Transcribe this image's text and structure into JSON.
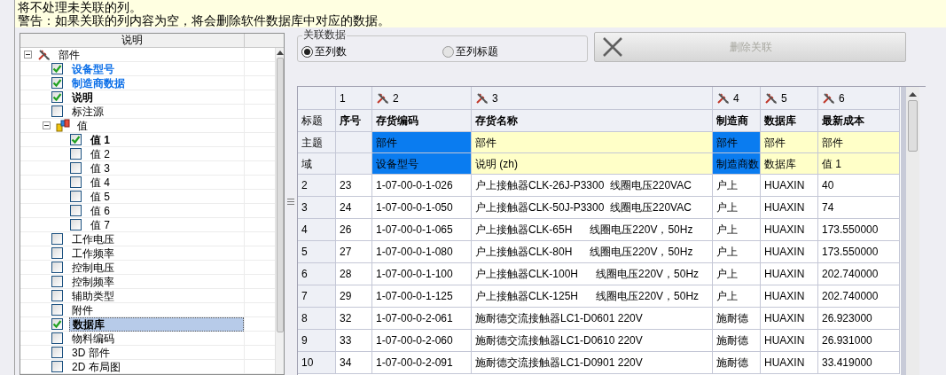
{
  "notice": {
    "lines": [
      "将不处理未关联的列。",
      "警告：如果关联的列内容为空，将会删除软件数据库中对应的数据。"
    ]
  },
  "tree": {
    "column_header": "说明",
    "items": [
      {
        "label": "部件",
        "kind": "component",
        "expanded": true,
        "children": [
          {
            "label": "设备型号",
            "kind": "field",
            "checked": true,
            "linked": true,
            "selected": false
          },
          {
            "label": "制造商数据",
            "kind": "field",
            "checked": true,
            "linked": true,
            "selected": false
          },
          {
            "label": "说明",
            "kind": "field",
            "checked": true,
            "linked": false,
            "selected": false
          },
          {
            "label": "标注源",
            "kind": "field",
            "checked": false,
            "linked": false,
            "selected": false
          },
          {
            "label": "值",
            "kind": "value-set",
            "expanded": true,
            "children": [
              {
                "label": "值 1",
                "kind": "field",
                "checked": true,
                "linked": false,
                "selected": false
              },
              {
                "label": "值 2",
                "kind": "field",
                "checked": false,
                "linked": false,
                "selected": false
              },
              {
                "label": "值 3",
                "kind": "field",
                "checked": false,
                "linked": false,
                "selected": false
              },
              {
                "label": "值 4",
                "kind": "field",
                "checked": false,
                "linked": false,
                "selected": false
              },
              {
                "label": "值 5",
                "kind": "field",
                "checked": false,
                "linked": false,
                "selected": false
              },
              {
                "label": "值 6",
                "kind": "field",
                "checked": false,
                "linked": false,
                "selected": false
              },
              {
                "label": "值 7",
                "kind": "field",
                "checked": false,
                "linked": false,
                "selected": false
              }
            ]
          },
          {
            "label": "工作电压",
            "kind": "field",
            "checked": false,
            "linked": false,
            "selected": false
          },
          {
            "label": "工作频率",
            "kind": "field",
            "checked": false,
            "linked": false,
            "selected": false
          },
          {
            "label": "控制电压",
            "kind": "field",
            "checked": false,
            "linked": false,
            "selected": false
          },
          {
            "label": "控制频率",
            "kind": "field",
            "checked": false,
            "linked": false,
            "selected": false
          },
          {
            "label": "辅助类型",
            "kind": "field",
            "checked": false,
            "linked": false,
            "selected": false
          },
          {
            "label": "附件",
            "kind": "field",
            "checked": false,
            "linked": false,
            "selected": false
          },
          {
            "label": "数据库",
            "kind": "field",
            "checked": true,
            "linked": false,
            "selected": true
          },
          {
            "label": "物料编码",
            "kind": "field",
            "checked": false,
            "linked": false,
            "selected": false
          },
          {
            "label": "3D 部件",
            "kind": "field",
            "checked": false,
            "linked": false,
            "selected": false
          },
          {
            "label": "2D 布局图",
            "kind": "field",
            "checked": false,
            "linked": false,
            "selected": false
          }
        ]
      }
    ]
  },
  "link_group": {
    "title": "关联数据",
    "options": [
      {
        "label": "至列数",
        "selected": true
      },
      {
        "label": "至列标题",
        "selected": false
      }
    ]
  },
  "delete_button": {
    "label": "删除关联",
    "disabled": true
  },
  "table": {
    "row_labels": [
      "标题",
      "主题",
      "域"
    ],
    "columns": [
      {
        "number": "1",
        "linked": false,
        "selected": false,
        "title": "序号"
      },
      {
        "number": "2",
        "linked": true,
        "selected": true,
        "title": "存货编码",
        "subject": "部件",
        "field": "设备型号"
      },
      {
        "number": "3",
        "linked": true,
        "selected": false,
        "title": "存货名称",
        "subject": "部件",
        "field": "说明 (zh)"
      },
      {
        "number": "4",
        "linked": true,
        "selected": true,
        "title": "制造商",
        "subject": "部件",
        "field": "制造商数"
      },
      {
        "number": "5",
        "linked": true,
        "selected": false,
        "title": "数据库",
        "subject": "部件",
        "field": "数据库"
      },
      {
        "number": "6",
        "linked": true,
        "selected": false,
        "title": "最新成本",
        "subject": "部件",
        "field": "值 1"
      }
    ],
    "rows": [
      {
        "row": "2",
        "cells": [
          "23",
          "1-07-00-0-1-026",
          "户上接触器CLK-26J-P3300  线圈电压220VAC",
          "户上",
          "HUAXIN",
          "40"
        ]
      },
      {
        "row": "3",
        "cells": [
          "24",
          "1-07-00-0-1-050",
          "户上接触器CLK-50J-P3300  线圈电压220VAC",
          "户上",
          "HUAXIN",
          "74"
        ]
      },
      {
        "row": "4",
        "cells": [
          "26",
          "1-07-00-0-1-065",
          "户上接触器CLK-65H      线圈电压220V，50Hz",
          "户上",
          "HUAXIN",
          "173.550000"
        ]
      },
      {
        "row": "5",
        "cells": [
          "27",
          "1-07-00-0-1-080",
          "户上接触器CLK-80H      线圈电压220V，50Hz",
          "户上",
          "HUAXIN",
          "173.550000"
        ]
      },
      {
        "row": "6",
        "cells": [
          "28",
          "1-07-00-0-1-100",
          "户上接触器CLK-100H      线圈电压220V，50Hz",
          "户上",
          "HUAXIN",
          "202.740000"
        ]
      },
      {
        "row": "7",
        "cells": [
          "29",
          "1-07-00-0-1-125",
          "户上接触器CLK-125H      线圈电压220V，50Hz",
          "户上",
          "HUAXIN",
          "202.740000"
        ]
      },
      {
        "row": "8",
        "cells": [
          "32",
          "1-07-00-0-2-061",
          "施耐德交流接触器LC1-D0601 220V",
          "施耐德",
          "HUAXIN",
          "26.923000"
        ]
      },
      {
        "row": "9",
        "cells": [
          "33",
          "1-07-00-0-2-060",
          "施耐德交流接触器LC1-D0610 220V",
          "施耐德",
          "HUAXIN",
          "26.931000"
        ]
      },
      {
        "row": "10",
        "cells": [
          "34",
          "1-07-00-0-2-091",
          "施耐德交流接触器LC1-D0901 220V",
          "施耐德",
          "HUAXIN",
          "33.419000"
        ]
      }
    ]
  }
}
